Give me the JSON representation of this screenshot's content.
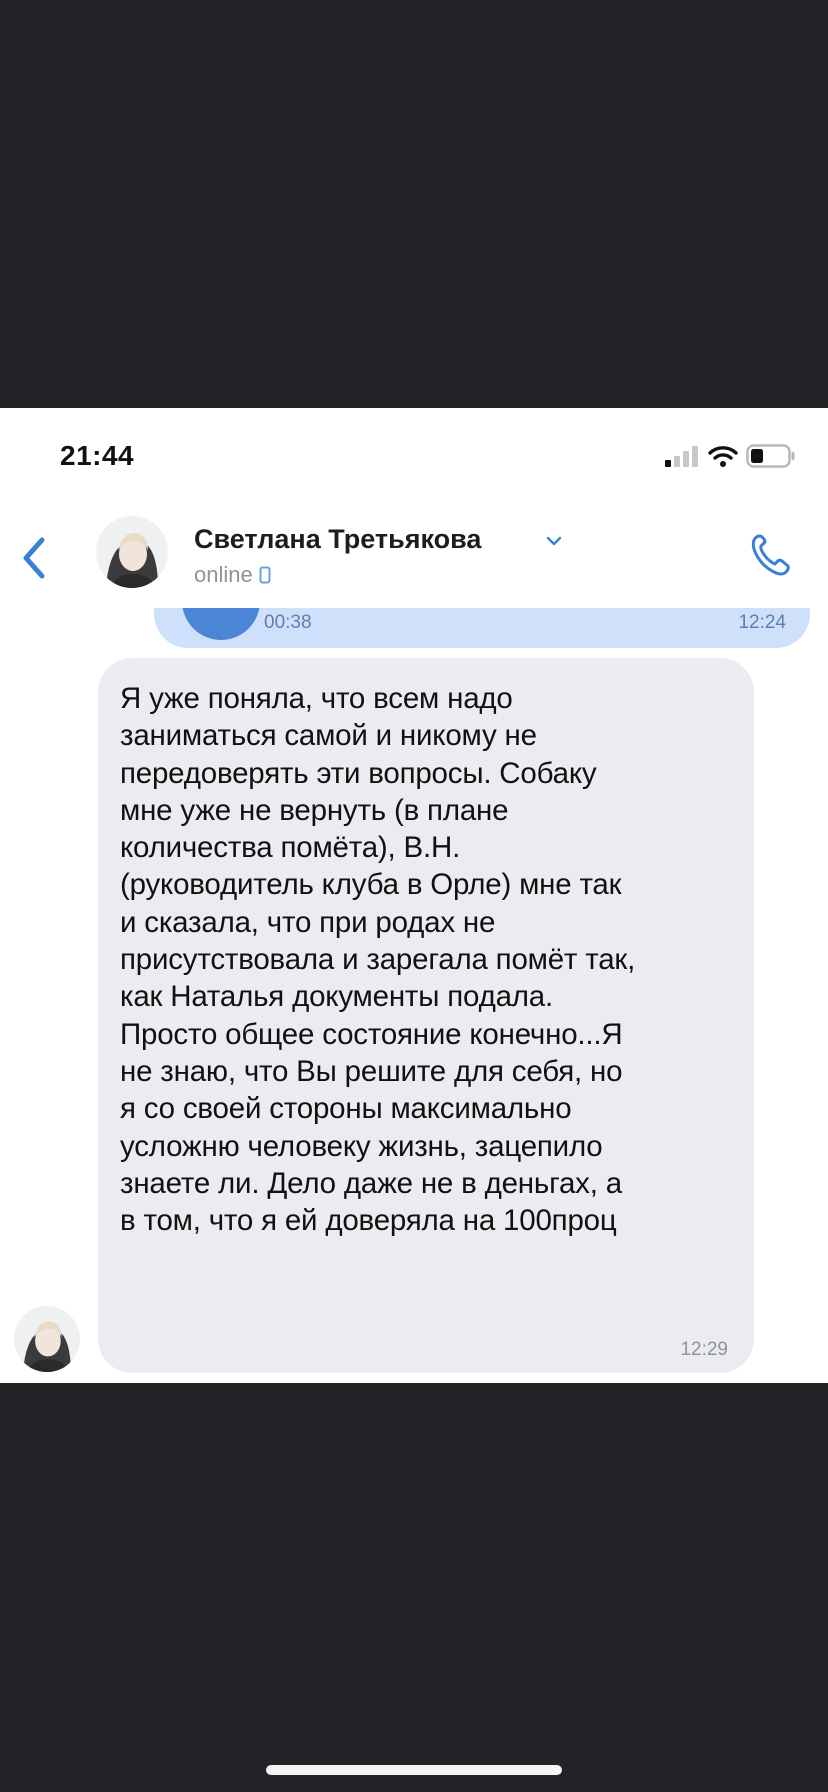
{
  "status_bar": {
    "time": "21:44"
  },
  "header": {
    "contact_name": "Светлана Третьякова",
    "status": "online",
    "icons": {
      "back": "chevron-left-icon",
      "dropdown": "chevron-down-icon",
      "call": "phone-icon",
      "device": "mobile-device-icon"
    }
  },
  "voice_message": {
    "duration": "00:38",
    "time": "12:24"
  },
  "message": {
    "lines": [
      "Я уже поняла, что всем надо",
      "заниматься самой и никому не",
      "передоверять эти вопросы. Собаку",
      "мне уже не вернуть (в плане",
      "количества помёта), В.Н.",
      "(руководитель клуба в Орле) мне так",
      "и сказала, что при родах не",
      "присутствовала и зарегала помёт так,",
      "как Наталья документы подала.",
      "Просто общее состояние конечно...Я",
      "не знаю, что Вы решите для себя, но",
      "я со своей стороны максимально",
      "усложню человеку жизнь, зацепило",
      "знаете ли. Дело даже не в деньгах, а",
      "в том, что я ей доверяла на 100проц"
    ],
    "time": "12:29"
  },
  "colors": {
    "accent": "#4b86d6",
    "bubble_incoming": "#ebecf0",
    "bubble_outgoing": "#cfe1fa",
    "frame_background": "#232427",
    "muted_text": "#8e939a"
  }
}
